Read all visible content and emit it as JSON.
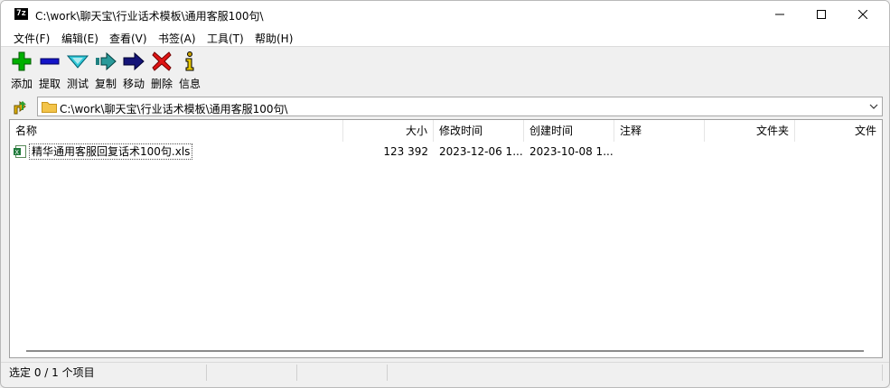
{
  "window": {
    "app_icon": "7z",
    "title": "C:\\work\\聊天宝\\行业话术模板\\通用客服100句\\"
  },
  "menu": [
    {
      "label": "文件(F)"
    },
    {
      "label": "编辑(E)"
    },
    {
      "label": "查看(V)"
    },
    {
      "label": "书签(A)"
    },
    {
      "label": "工具(T)"
    },
    {
      "label": "帮助(H)"
    }
  ],
  "toolbar": [
    {
      "label": "添加",
      "icon": "plus-icon",
      "color": "#00a000"
    },
    {
      "label": "提取",
      "icon": "minus-icon",
      "color": "#1010c0"
    },
    {
      "label": "测试",
      "icon": "check-chevron-icon",
      "color": "#20b0c0"
    },
    {
      "label": "复制",
      "icon": "copy-arrow-icon",
      "color": "#208080"
    },
    {
      "label": "移动",
      "icon": "move-arrow-icon",
      "color": "#101070"
    },
    {
      "label": "删除",
      "icon": "delete-x-icon",
      "color": "#e01010"
    },
    {
      "label": "信息",
      "icon": "info-icon",
      "color": "#c0a000"
    }
  ],
  "address": {
    "path": "C:\\work\\聊天宝\\行业话术模板\\通用客服100句\\"
  },
  "columns": [
    {
      "label": "名称"
    },
    {
      "label": "大小"
    },
    {
      "label": "修改时间"
    },
    {
      "label": "创建时间"
    },
    {
      "label": "注释"
    },
    {
      "label": "文件夹"
    },
    {
      "label": "文件"
    }
  ],
  "rows": [
    {
      "name": "精华通用客服回复话术100句.xls",
      "size": "123 392",
      "modified": "2023-12-06 1...",
      "created": "2023-10-08 1...",
      "comment": "",
      "folders": "",
      "files": ""
    }
  ],
  "status": {
    "selection": "选定 0 / 1 个项目",
    "seg2": "",
    "seg3": "",
    "seg4": ""
  }
}
